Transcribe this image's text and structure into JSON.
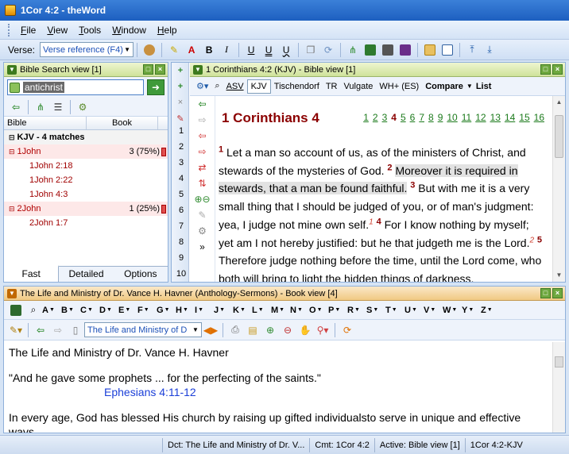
{
  "window": {
    "title": "1Cor 4:2 - theWord"
  },
  "menu": [
    {
      "pre": "",
      "u": "F",
      "post": "ile"
    },
    {
      "pre": "",
      "u": "V",
      "post": "iew"
    },
    {
      "pre": "",
      "u": "T",
      "post": "ools"
    },
    {
      "pre": "",
      "u": "W",
      "post": "indow"
    },
    {
      "pre": "",
      "u": "H",
      "post": "elp"
    }
  ],
  "toolbar": {
    "verse_label": "Verse:",
    "verse_combo": "Verse reference (F4)"
  },
  "search_panel": {
    "title": "Bible Search view [1]",
    "query": "antichrist",
    "col_bible": "Bible",
    "col_book": "Book",
    "kjv_label": "KJV  - 4 matches",
    "groups": [
      {
        "book": "1John",
        "count": "3 (75%)",
        "verses": [
          "1John 2:18",
          "1John 2:22",
          "1John 4:3"
        ]
      },
      {
        "book": "2John",
        "count": "1 (25%)",
        "verses": [
          "2John 1:7"
        ]
      }
    ],
    "tabs": [
      "Fast",
      "Detailed",
      "Options"
    ]
  },
  "bible_panel": {
    "title": "1 Corinthians 4:2 (KJV)  -  Bible view [1]",
    "tabs": [
      "ASV",
      "KJV",
      "Tischendorf",
      "TR",
      "Vulgate",
      "WH+ (ES)",
      "Compare",
      "List"
    ],
    "active_tab": "KJV",
    "nav_numbers": [
      "1",
      "2",
      "3",
      "4",
      "5",
      "6",
      "7",
      "8",
      "9",
      "10"
    ],
    "chapter_title": "1 Corinthians 4",
    "chapters": [
      "1",
      "2",
      "3",
      "4",
      "5",
      "6",
      "7",
      "8",
      "9",
      "10",
      "11",
      "12",
      "13",
      "14",
      "15",
      "16"
    ],
    "current_chapter": "4",
    "verses": {
      "v1": "Let a man so account of us, as of the ministers of Christ, and stewards of the mysteries of God.",
      "v2": "Moreover it is required in stewards, that a man be found faithful.",
      "v3a": "But with me it is a very small thing that I should be judged of you, or of man's judgment: yea, I judge not mine own self.",
      "fn1": "1",
      "v4a": "For I know nothing by myself; yet am I not hereby justified: but he that judgeth me is the Lord.",
      "fn2": "2",
      "v5": "Therefore judge nothing before the time, until the Lord come, who both will bring to light the hidden things of darkness,"
    }
  },
  "book_panel": {
    "title": "The Life and Ministry of Dr. Vance H. Havner (Anthology-Sermons)  -  Book view [4]",
    "letters": [
      "A",
      "B",
      "C",
      "D",
      "E",
      "F",
      "G",
      "H",
      "I",
      "J",
      "K",
      "L",
      "M",
      "N",
      "O",
      "P",
      "R",
      "S",
      "T",
      "U",
      "V",
      "W",
      "Y",
      "Z"
    ],
    "book_combo": "The Life and Ministry of D",
    "p1": "The Life and Ministry of Dr. Vance H. Havner",
    "p2": "\"And he gave some prophets ... for the perfecting of the saints.\"",
    "p2_ref": "Ephesians 4:11-12",
    "p3": "In every age, God has blessed His church by raising up gifted individualsto serve in unique and effective ways."
  },
  "status": {
    "dct": "Dct: The Life and Ministry of Dr. V...",
    "cmt": "Cmt: 1Cor 4:2",
    "active": "Active: Bible view [1]",
    "ref": "1Cor 4:2-KJV"
  }
}
